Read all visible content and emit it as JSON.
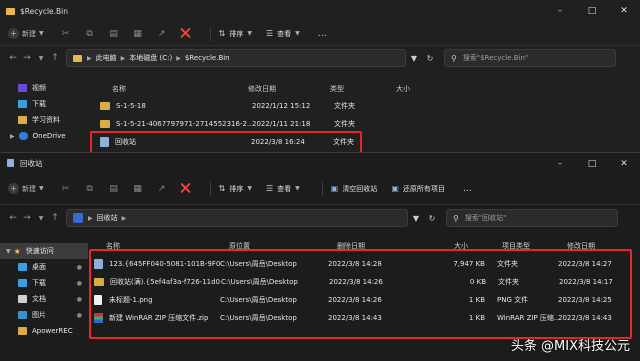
{
  "win1": {
    "title": "$Recycle.Bin",
    "toolbar": {
      "new": "新建",
      "sort": "排序",
      "view": "查看"
    },
    "address": [
      "此电脑",
      "本地磁盘 (C:)",
      "$Recycle.Bin"
    ],
    "search_placeholder": "搜索\"$Recycle.Bin\"",
    "nav": [
      {
        "label": "视频",
        "color": "#6a4bd6"
      },
      {
        "label": "下载",
        "color": "#3aa0e0"
      },
      {
        "label": "学习资料",
        "color": "#d9ac45"
      },
      {
        "label": "OneDrive",
        "color": "#2f7ed8"
      }
    ],
    "columns": {
      "name": "名称",
      "date": "修改日期",
      "type": "类型",
      "size": "大小"
    },
    "rows": [
      {
        "name": "S-1-5-18",
        "date": "2022/1/12 15:12",
        "type": "文件夹",
        "icon": "folder"
      },
      {
        "name": "S-1-5-21-4067797971-2714552316-2...",
        "date": "2022/1/11 21:18",
        "type": "文件夹",
        "icon": "folder"
      },
      {
        "name": "回收站",
        "date": "2022/3/8 16:24",
        "type": "文件夹",
        "icon": "recycle"
      }
    ]
  },
  "win2": {
    "title": "回收站",
    "toolbar": {
      "new": "新建",
      "sort": "排序",
      "view": "查看",
      "empty": "清空回收站",
      "restore_all": "还原所有项目"
    },
    "address": [
      "回收站"
    ],
    "search_placeholder": "搜索\"回收站\"",
    "nav": [
      {
        "label": "快速访问",
        "color": "#f2c744",
        "pinned": false,
        "sel": true
      },
      {
        "label": "桌面",
        "color": "#3aa0e0",
        "pinned": true
      },
      {
        "label": "下载",
        "color": "#3aa0e0",
        "pinned": true
      },
      {
        "label": "文档",
        "color": "#d0d0d0",
        "pinned": true
      },
      {
        "label": "图片",
        "color": "#3a8fd0",
        "pinned": true
      },
      {
        "label": "ApowerREC",
        "color": "#d9ac45",
        "pinned": false
      }
    ],
    "columns": {
      "name": "名称",
      "orig": "原位置",
      "deleted": "删除日期",
      "size": "大小",
      "type": "项目类型",
      "modified": "修改日期"
    },
    "rows": [
      {
        "name": "123.{645FF040-5081-101B-9F08-...",
        "orig": "C:\\Users\\周岳\\Desktop",
        "deleted": "2022/3/8 14:28",
        "size": "7,947 KB",
        "type": "文件夹",
        "modified": "2022/3/8 14:27",
        "icon": "recycle"
      },
      {
        "name": "回收站(满).{5ef4af3a-f726-11d0-...",
        "orig": "C:\\Users\\周岳\\Desktop",
        "deleted": "2022/3/8 14:26",
        "size": "0 KB",
        "type": "文件夹",
        "modified": "2022/3/8 14:17",
        "icon": "folder"
      },
      {
        "name": "未标题-1.png",
        "orig": "C:\\Users\\周岳\\Desktop",
        "deleted": "2022/3/8 14:26",
        "size": "1 KB",
        "type": "PNG 文件",
        "modified": "2022/3/8 14:25",
        "icon": "png"
      },
      {
        "name": "新建 WinRAR ZIP 压缩文件.zip",
        "orig": "C:\\Users\\周岳\\Desktop",
        "deleted": "2022/3/8 14:43",
        "size": "1 KB",
        "type": "WinRAR ZIP 压缩...",
        "modified": "2022/3/8 14:43",
        "icon": "zip"
      }
    ]
  },
  "watermark": "头条 @MIX科技公元"
}
